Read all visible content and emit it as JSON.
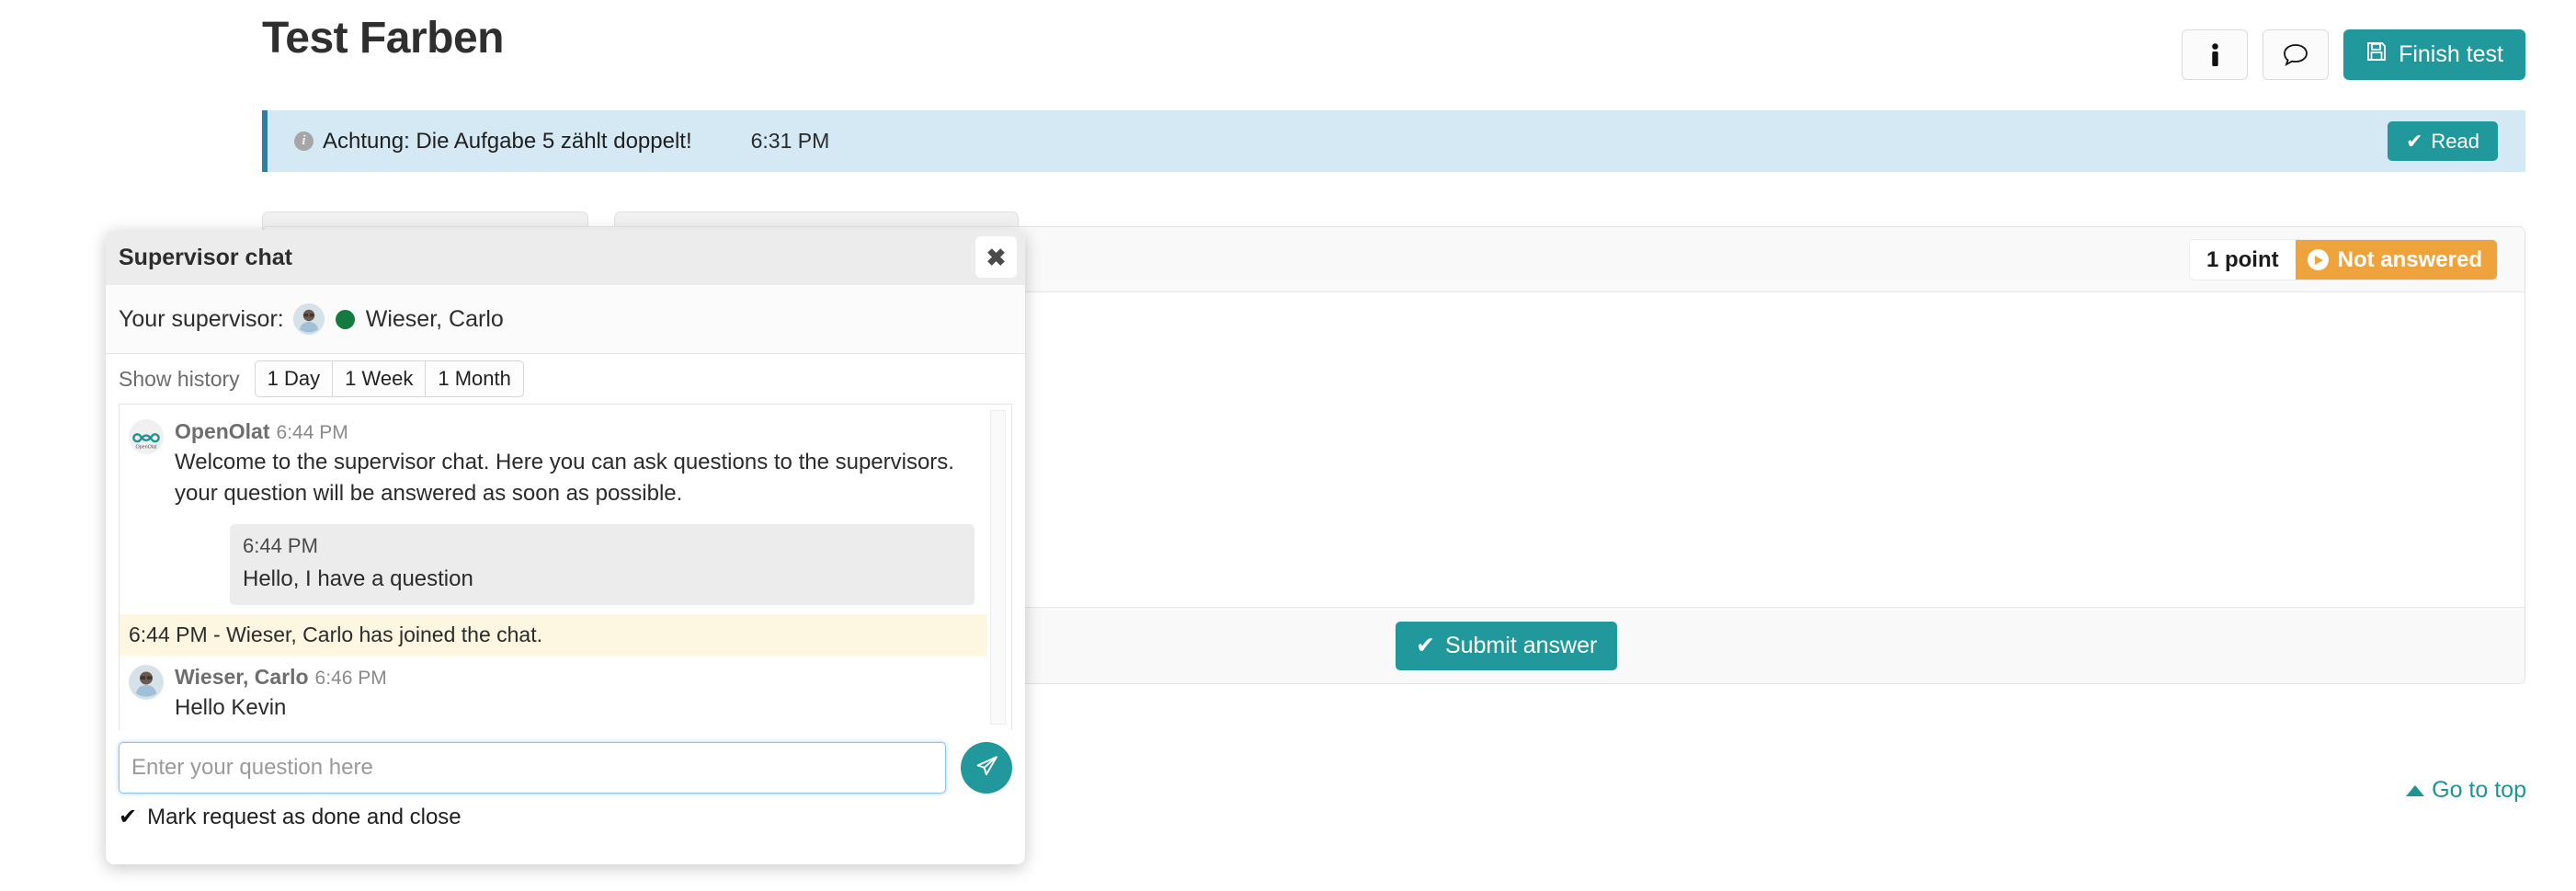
{
  "header": {
    "title": "Test Farben",
    "info_icon": "info-icon",
    "chat_icon": "speech-bubble-icon",
    "finish_label": "Finish test",
    "finish_icon": "floppy-disk-save-icon"
  },
  "alert": {
    "icon": "info-circle-icon",
    "message": "Achtung: Die Aufgabe 5 zählt doppelt!",
    "time": "6:31 PM",
    "read_label": "Read",
    "read_icon": "check-icon",
    "accent_color": "#2f7fa5",
    "background_color": "#d4e9f3"
  },
  "question_panel": {
    "points_label": "1 point",
    "status_label": "Not answered",
    "status_icon": "play-circle-icon",
    "status_color": "#efa33d",
    "submit_label": "Submit answer",
    "submit_icon": "check-icon"
  },
  "footer": {
    "go_to_top_label": "Go to top",
    "go_to_top_icon": "chevron-up-icon",
    "link_color": "#1f9497"
  },
  "chat": {
    "title": "Supervisor chat",
    "close_icon": "close-x-icon",
    "supervisor_label": "Your supervisor:",
    "supervisor_name": "Wieser, Carlo",
    "supervisor_avatar": "user-photo-avatar",
    "status_dot": "online-status-dot",
    "status_color": "#147a3e",
    "history_label": "Show history",
    "history_options": [
      "1 Day",
      "1 Week",
      "1 Month"
    ],
    "messages": [
      {
        "kind": "other",
        "avatar": "openolat-logo-avatar",
        "author": "OpenOlat",
        "time": "6:44 PM",
        "text": "Welcome to the supervisor chat. Here you can ask questions to the supervisors. your question will be answered as soon as possible."
      },
      {
        "kind": "own",
        "time": "6:44 PM",
        "text": "Hello, I have a question"
      },
      {
        "kind": "system",
        "text": "6:44 PM - Wieser, Carlo has joined the chat."
      },
      {
        "kind": "other",
        "avatar": "user-photo-avatar",
        "author": "Wieser, Carlo",
        "time": "6:46 PM",
        "text": "Hello Kevin"
      }
    ],
    "input_placeholder": "Enter your question here",
    "input_value": "",
    "send_icon": "paper-plane-send-icon",
    "done_label": "Mark request as done and close",
    "done_icon": "check-icon"
  },
  "theme": {
    "accent": "#21999c",
    "warning": "#efa33d",
    "info": "#d4e9f3"
  }
}
